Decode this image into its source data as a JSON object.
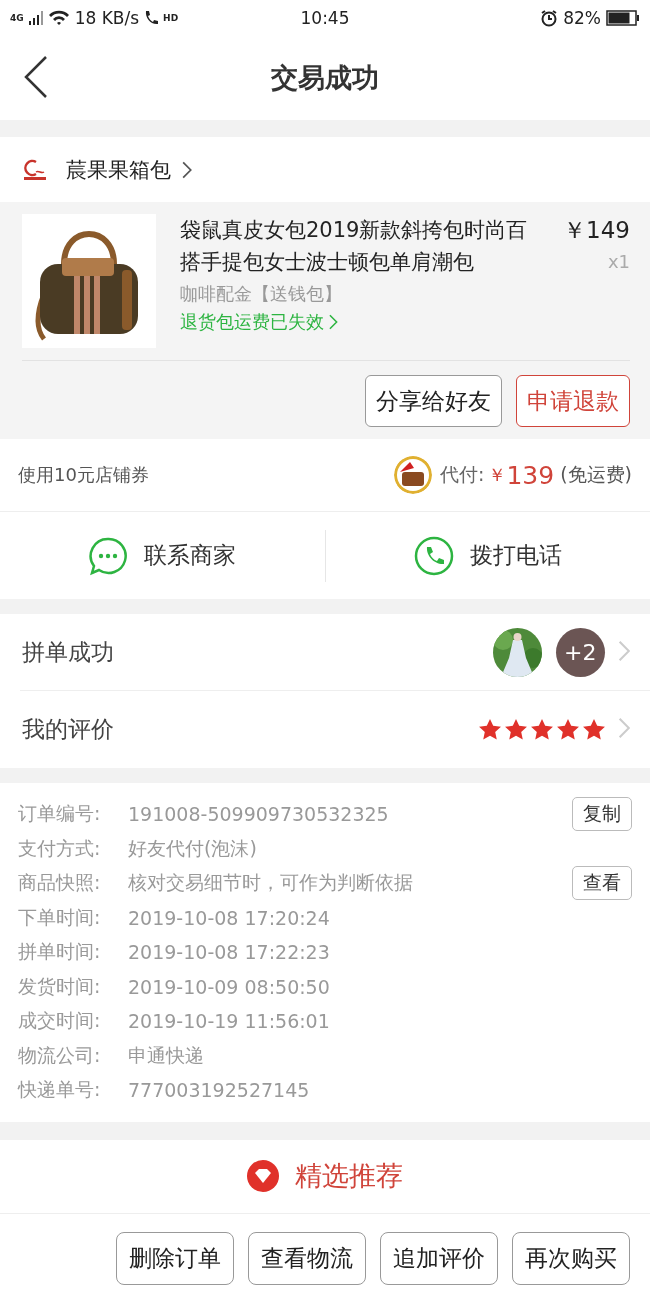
{
  "status_bar": {
    "network": "4G",
    "speed": "18 KB/s",
    "call": "HD",
    "time": "10:45",
    "battery": "82%"
  },
  "header": {
    "title": "交易成功"
  },
  "shop": {
    "name": "莀果果箱包"
  },
  "product": {
    "title": "袋鼠真皮女包2019新款斜挎包时尚百搭手提包女士波士顿包单肩潮包",
    "price": "￥149",
    "quantity": "x1",
    "variant": "咖啡配金【送钱包】",
    "return_note": "退货包运费已失效"
  },
  "product_buttons": [
    {
      "label": "分享给好友",
      "kind": "plain"
    },
    {
      "label": "申请退款",
      "kind": "accent"
    }
  ],
  "payment": {
    "coupon": "使用10元店铺券",
    "label": "代付:",
    "currency": "￥",
    "amount": "139",
    "note": "(免运费)"
  },
  "contact": [
    {
      "label": "联系商家",
      "kind": "chat"
    },
    {
      "label": "拨打电话",
      "kind": "phone"
    }
  ],
  "group": {
    "label": "拼单成功",
    "extra": "+2"
  },
  "review": {
    "label": "我的评价",
    "stars": 5
  },
  "info": [
    {
      "label": "订单编号:",
      "value": "191008-509909730532325",
      "action": "复制"
    },
    {
      "label": "支付方式:",
      "value": "好友代付(泡沫)"
    },
    {
      "label": "商品快照:",
      "value": "核对交易细节时，可作为判断依据",
      "action": "查看"
    },
    {
      "label": "下单时间:",
      "value": "2019-10-08 17:20:24"
    },
    {
      "label": "拼单时间:",
      "value": "2019-10-08 17:22:23"
    },
    {
      "label": "发货时间:",
      "value": "2019-10-09 08:50:50"
    },
    {
      "label": "成交时间:",
      "value": "2019-10-19 11:56:01"
    },
    {
      "label": "物流公司:",
      "value": "申通快递"
    },
    {
      "label": "快递单号:",
      "value": "777003192527145"
    }
  ],
  "recommend": {
    "label": "精选推荐"
  },
  "bottom_buttons": [
    "删除订单",
    "查看物流",
    "追加评价",
    "再次购买"
  ]
}
